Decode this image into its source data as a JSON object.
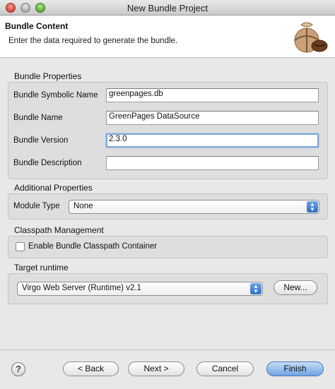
{
  "window": {
    "title": "New Bundle Project"
  },
  "header": {
    "title": "Bundle Content",
    "description": "Enter the data required to generate the bundle."
  },
  "bundle_properties": {
    "label": "Bundle Properties",
    "symbolic_name_label": "Bundle Symbolic Name",
    "symbolic_name_value": "greenpages.db",
    "name_label": "Bundle Name",
    "name_value": "GreenPages DataSource",
    "version_label": "Bundle Version",
    "version_value": "2.3.0",
    "description_label": "Bundle Description",
    "description_value": ""
  },
  "additional_properties": {
    "label": "Additional Properties",
    "module_type_label": "Module Type",
    "module_type_value": "None"
  },
  "classpath": {
    "label": "Classpath Management",
    "checkbox_label": "Enable Bundle Classpath Container",
    "checked": false
  },
  "runtime": {
    "label": "Target runtime",
    "selected": "Virgo Web Server (Runtime) v2.1",
    "new_button": "New..."
  },
  "footer": {
    "help_symbol": "?",
    "back": "< Back",
    "next": "Next >",
    "cancel": "Cancel",
    "finish": "Finish"
  }
}
